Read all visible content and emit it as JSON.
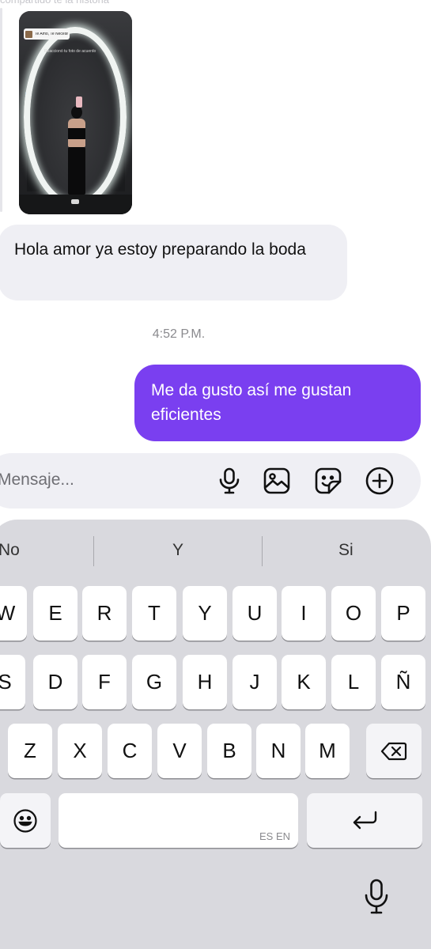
{
  "chat": {
    "faded_header": "compartido te la historia",
    "media": {
      "overlay_tag": "Te Amo, Te Necesito (Ren... Shakira",
      "overlay_caption": "Reaccionó tu foto de acuerdo"
    },
    "incoming_message": "Hola amor ya estoy preparando la boda",
    "timestamp": "4:52 P.M.",
    "outgoing_message": "Me da gusto así me gustan eficientes"
  },
  "composer": {
    "placeholder": "Mensaje...",
    "icons": [
      "microphone-icon",
      "image-icon",
      "sticker-icon",
      "add-circle-icon"
    ]
  },
  "keyboard": {
    "suggestions": [
      "No",
      "Y",
      "Si"
    ],
    "row1": [
      "W",
      "E",
      "R",
      "T",
      "Y",
      "U",
      "I",
      "O",
      "P"
    ],
    "row2": [
      "S",
      "D",
      "F",
      "G",
      "H",
      "J",
      "K",
      "L",
      "Ñ"
    ],
    "row3": [
      "Z",
      "X",
      "C",
      "V",
      "B",
      "N",
      "M"
    ],
    "space_lang": "ES EN",
    "accent_color": "#7a3ff0"
  }
}
